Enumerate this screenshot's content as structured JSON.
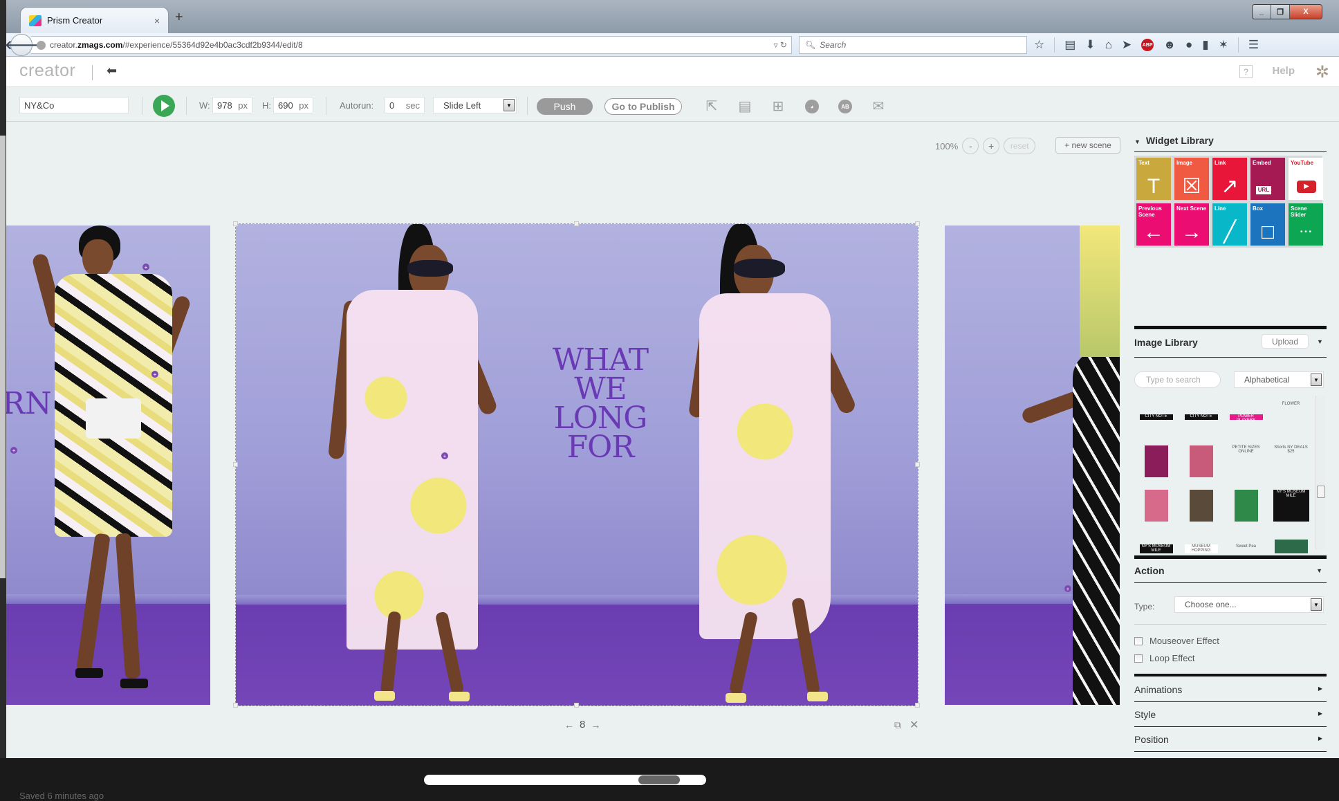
{
  "browser": {
    "tab_title": "Prism Creator",
    "tab_close": "×",
    "new_tab": "+",
    "url_prefix": "creator.",
    "url_domain": "zmags.com",
    "url_path": "/#experience/55364d92e4b0ac3cdf2b9344/edit/8",
    "search_placeholder": "Search",
    "window_controls": {
      "minimize": "_",
      "restore": "❐",
      "close": "X"
    }
  },
  "app": {
    "logo": "creator",
    "help_q": "?",
    "help": "Help"
  },
  "toolbar": {
    "name_value": "NY&Co",
    "width_label": "W:",
    "width_value": "978",
    "height_label": "H:",
    "height_value": "690",
    "unit": "px",
    "autorun_label": "Autorun:",
    "autorun_value": "0",
    "autorun_unit": "sec",
    "transition": "Slide Left",
    "push": "Push",
    "publish": "Go to Publish",
    "icons": [
      "share-icon",
      "comment-icon",
      "add-comment-icon",
      "globe-icon",
      "ab-test-icon",
      "email-icon"
    ],
    "ab_text": "AB"
  },
  "canvas": {
    "zoom_level": "100%",
    "zoom_out": "-",
    "zoom_in": "+",
    "reset": "reset",
    "new_scene": "+ new scene",
    "headline": [
      "WHAT",
      "WE",
      "LONG",
      "FOR"
    ],
    "left_slide_text": "RN",
    "page_prev": "←",
    "page_number": "8",
    "page_next": "→",
    "saved_status": "Saved 6 minutes ago",
    "colors": {
      "headline": "#6a3ab4",
      "wall": "#a9a8dc",
      "floor": "#6c3fb2"
    }
  },
  "panel": {
    "widget_library": "Widget Library",
    "widgets": [
      {
        "label": "Text",
        "color": "#c9a83e",
        "glyph": "T"
      },
      {
        "label": "Image",
        "color": "#f15a42",
        "glyph": "☒"
      },
      {
        "label": "Link",
        "color": "#e8173a",
        "glyph": "↗"
      },
      {
        "label": "Embed",
        "color": "#a51a52",
        "glyph": "URL"
      },
      {
        "label": "YouTube",
        "color": "#ffffff",
        "glyph": "▶"
      },
      {
        "label": "Previous Scene",
        "color": "#ec0d73",
        "glyph": "←"
      },
      {
        "label": "Next Scene",
        "color": "#ec0d73",
        "glyph": "→"
      },
      {
        "label": "Line",
        "color": "#08b8c8",
        "glyph": "╱"
      },
      {
        "label": "Box",
        "color": "#1c74bf",
        "glyph": "□"
      },
      {
        "label": "Scene Slider",
        "color": "#0da653",
        "glyph": "• • •"
      }
    ],
    "image_library": "Image Library",
    "upload": "Upload",
    "search_placeholder": "Type to search",
    "sort": "Alphabetical",
    "thumbnails": [
      {
        "bg": "#111111",
        "text": "CITY NOTE"
      },
      {
        "bg": "#111111",
        "text": "CITY NOTE"
      },
      {
        "bg": "#e8198b",
        "text": "POWER PLAYERS"
      },
      {
        "bg": "#eef1f1",
        "text": "FLOWER"
      },
      {
        "bg": "#8a1d5a",
        "text": ""
      },
      {
        "bg": "#c85a7a",
        "text": ""
      },
      {
        "bg": "#eef1f1",
        "text": "PETITE SIZES ONLINE"
      },
      {
        "bg": "#eef1f1",
        "text": "Shorts NY DEALS $25"
      },
      {
        "bg": "#d76a8a",
        "text": ""
      },
      {
        "bg": "#5a4a3a",
        "text": ""
      },
      {
        "bg": "#2f8a4a",
        "text": ""
      },
      {
        "bg": "#111111",
        "text": "NY'S MUSEUM MILE"
      },
      {
        "bg": "#111111",
        "text": "NY'S MUSEUM MILE"
      },
      {
        "bg": "#ffffff",
        "text": "MUSEUM HOPPING"
      },
      {
        "bg": "#eef1f1",
        "text": "Sweet Pea"
      },
      {
        "bg": "#2c6a4a",
        "text": ""
      }
    ],
    "action": "Action",
    "type_label": "Type:",
    "type_value": "Choose one...",
    "mouseover": "Mouseover Effect",
    "loop": "Loop Effect",
    "animations": "Animations",
    "style": "Style",
    "position": "Position"
  }
}
